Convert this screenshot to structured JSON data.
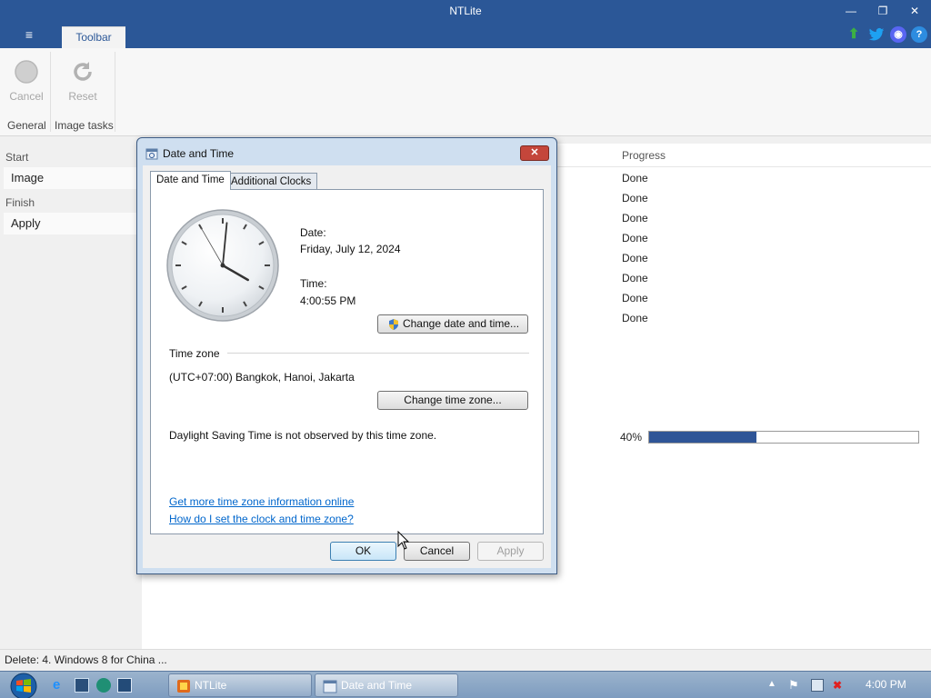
{
  "app": {
    "title": "NTLite",
    "tab": "Toolbar",
    "ribbon": {
      "cancel_label": "Cancel",
      "reset_label": "Reset",
      "group_general": "General",
      "group_image_tasks": "Image tasks"
    },
    "sidebar": {
      "start_header": "Start",
      "image_item": "Image",
      "finish_header": "Finish",
      "apply_item": "Apply"
    },
    "progress": {
      "header": "Progress",
      "items": [
        "Done",
        "Done",
        "Done",
        "Done",
        "Done",
        "Done",
        "Done",
        "Done"
      ],
      "percent_label": "40%",
      "percent_value": 0.4
    },
    "status_text": "Delete: 4. Windows 8 for China ..."
  },
  "dialog": {
    "title": "Date and Time",
    "tabs": [
      "Date and Time",
      "Additional Clocks"
    ],
    "date_label": "Date:",
    "date_value": "Friday, July 12, 2024",
    "time_label": "Time:",
    "time_value": "4:00:55 PM",
    "change_date_button": "Change date and time...",
    "timezone_header": "Time zone",
    "timezone_value": "(UTC+07:00) Bangkok, Hanoi, Jakarta",
    "change_timezone_button": "Change time zone...",
    "dst_note": "Daylight Saving Time is not observed by this time zone.",
    "link_more_info": "Get more time zone information online",
    "link_how_to": "How do I set the clock and time zone?",
    "ok_button": "OK",
    "cancel_button": "Cancel",
    "apply_button": "Apply",
    "clock": {
      "hours": 4,
      "minutes": 0,
      "seconds": 55
    }
  },
  "taskbar": {
    "tasks": [
      "NTLite",
      "Date and Time"
    ],
    "clock": "4:00 PM"
  },
  "colors": {
    "accent": "#2b5797",
    "progress_fill": "#2f5597",
    "link": "#0066cc"
  }
}
